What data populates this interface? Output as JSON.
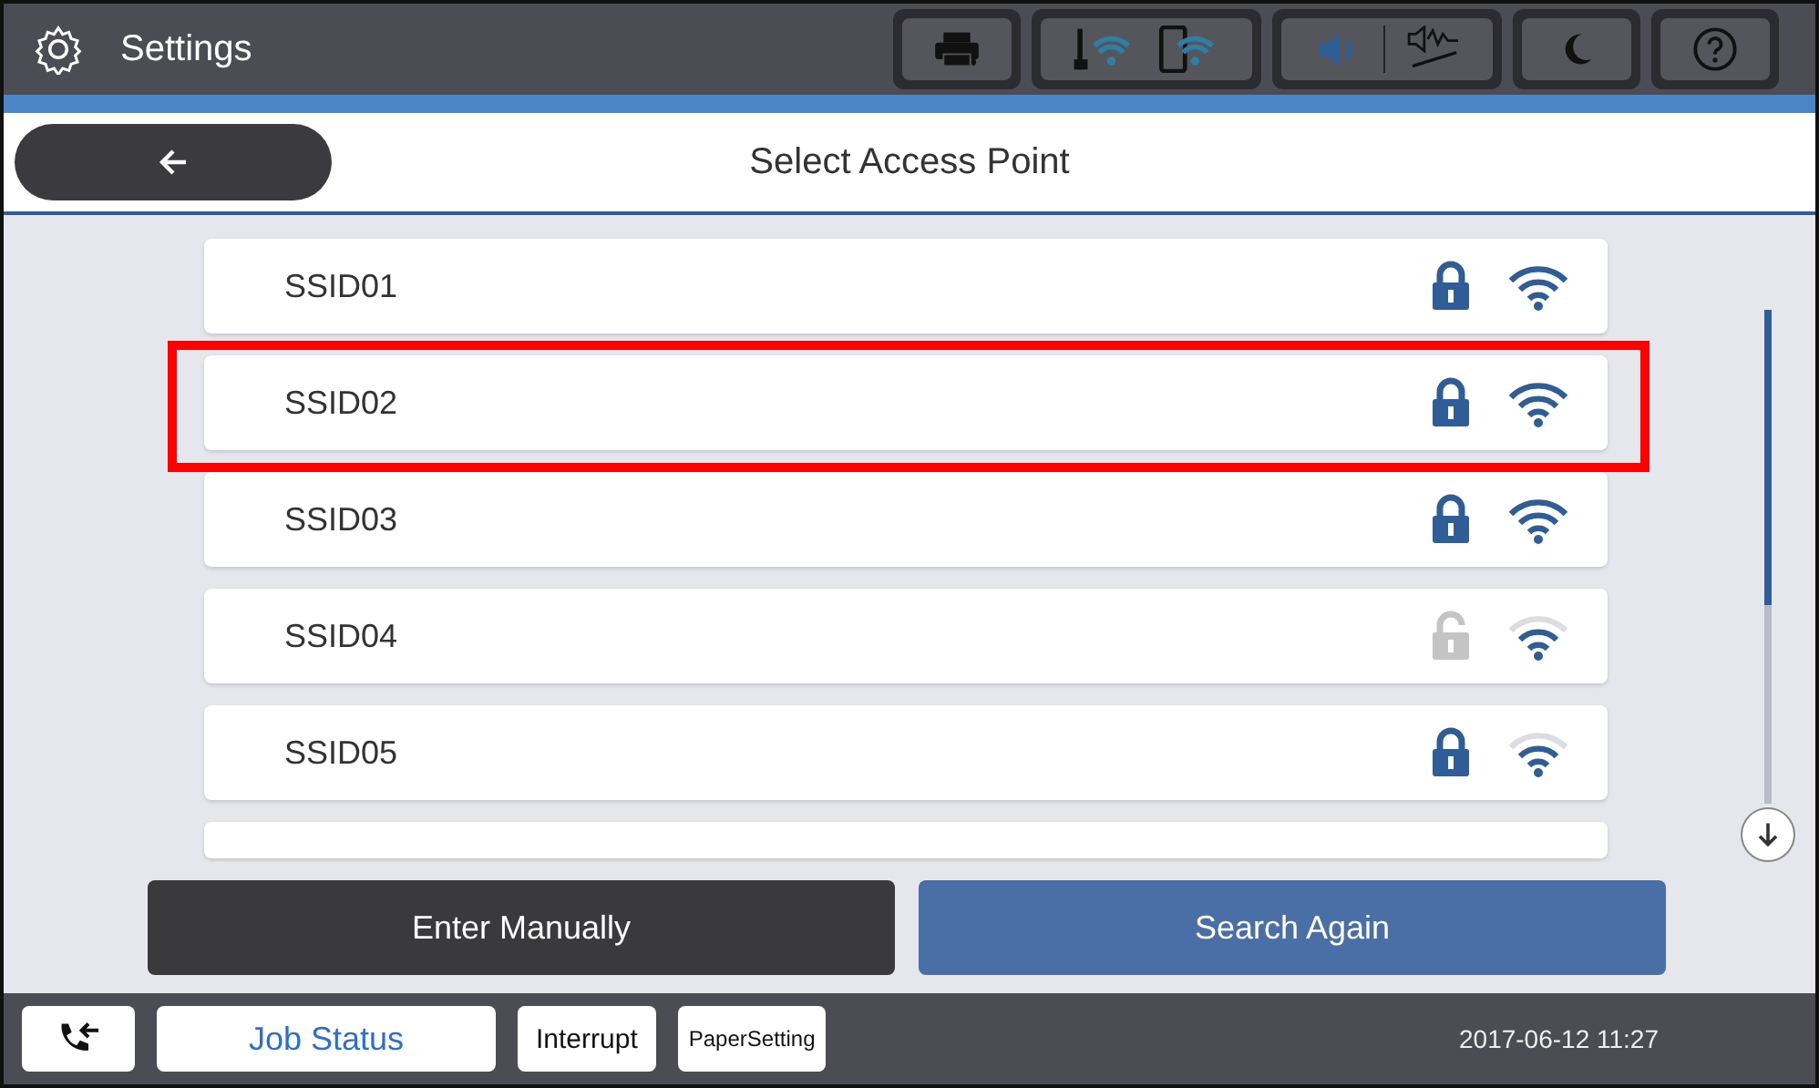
{
  "top_bar": {
    "title": "Settings"
  },
  "header": {
    "title": "Select Access Point"
  },
  "access_points": [
    {
      "ssid": "SSID01",
      "locked": true,
      "weak_signal": false,
      "highlighted": false
    },
    {
      "ssid": "SSID02",
      "locked": true,
      "weak_signal": false,
      "highlighted": true
    },
    {
      "ssid": "SSID03",
      "locked": true,
      "weak_signal": false,
      "highlighted": false
    },
    {
      "ssid": "SSID04",
      "locked": false,
      "weak_signal": true,
      "highlighted": false
    },
    {
      "ssid": "SSID05",
      "locked": true,
      "weak_signal": true,
      "highlighted": false
    }
  ],
  "buttons": [
    {
      "label": "Enter Manually",
      "kind": "dark"
    },
    {
      "label": "Search Again",
      "kind": "primary"
    }
  ],
  "status_bar": {
    "job_status": "Job Status",
    "interrupt": "Interrupt",
    "paper_setting": "PaperSetting",
    "datetime": "2017-06-12 11:27"
  }
}
